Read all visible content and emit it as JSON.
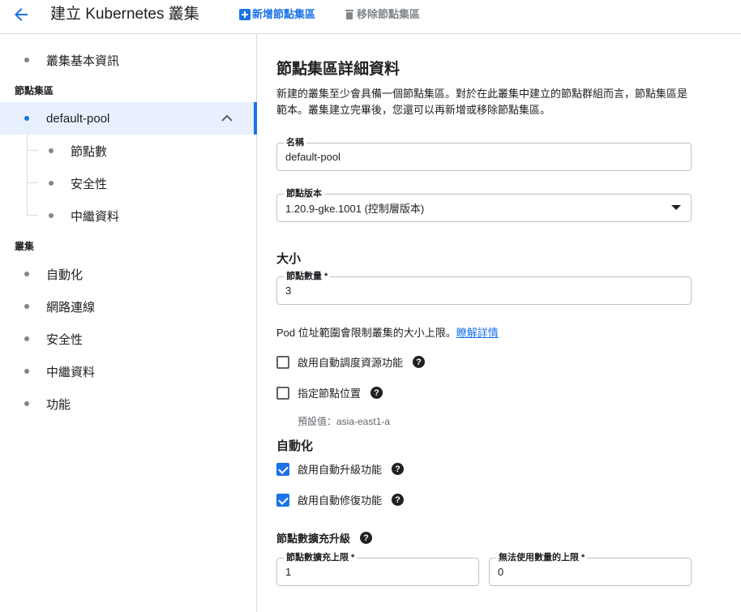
{
  "header": {
    "title": "建立 Kubernetes 叢集",
    "add_pool_label": "新增節點集區",
    "remove_pool_label": "移除節點集區"
  },
  "sidebar": {
    "cluster_basics": "叢集基本資訊",
    "node_pools_section": "節點集區",
    "pool_name": "default-pool",
    "pool_children": [
      "節點數",
      "安全性",
      "中繼資料"
    ],
    "cluster_section": "叢集",
    "cluster_items": [
      "自動化",
      "網路連線",
      "安全性",
      "中繼資料",
      "功能"
    ]
  },
  "main": {
    "title": "節點集區詳細資料",
    "description": "新建的叢集至少會具備一個節點集區。對於在此叢集中建立的節點群組而言，節點集區是範本。叢集建立完畢後，您還可以再新增或移除節點集區。",
    "name_field": {
      "label": "名稱",
      "value": "default-pool"
    },
    "version_field": {
      "label": "節點版本",
      "value": "1.20.9-gke.1001 (控制層版本)"
    },
    "size_title": "大小",
    "node_count_field": {
      "label": "節點數量 *",
      "value": "3"
    },
    "pod_note": "Pod 位址範圍會限制叢集的大小上限。",
    "learn_more": "瞭解詳情",
    "autoscaling_label": "啟用自動調度資源功能",
    "node_locations_label": "指定節點位置",
    "default_value_note": "預設值：asia-east1-a",
    "automation_title": "自動化",
    "auto_upgrade_label": "啟用自動升級功能",
    "auto_repair_label": "啟用自動修復功能",
    "surge_title": "節點數擴充升級",
    "max_surge_field": {
      "label": "節點數擴充上限 *",
      "value": "1"
    },
    "max_unavailable_field": {
      "label": "無法使用數量的上限 *",
      "value": "0"
    },
    "help_glyph": "?"
  },
  "colors": {
    "accent": "#1a73e8",
    "active_bg": "#e8f0fe",
    "border": "#dadce0"
  }
}
